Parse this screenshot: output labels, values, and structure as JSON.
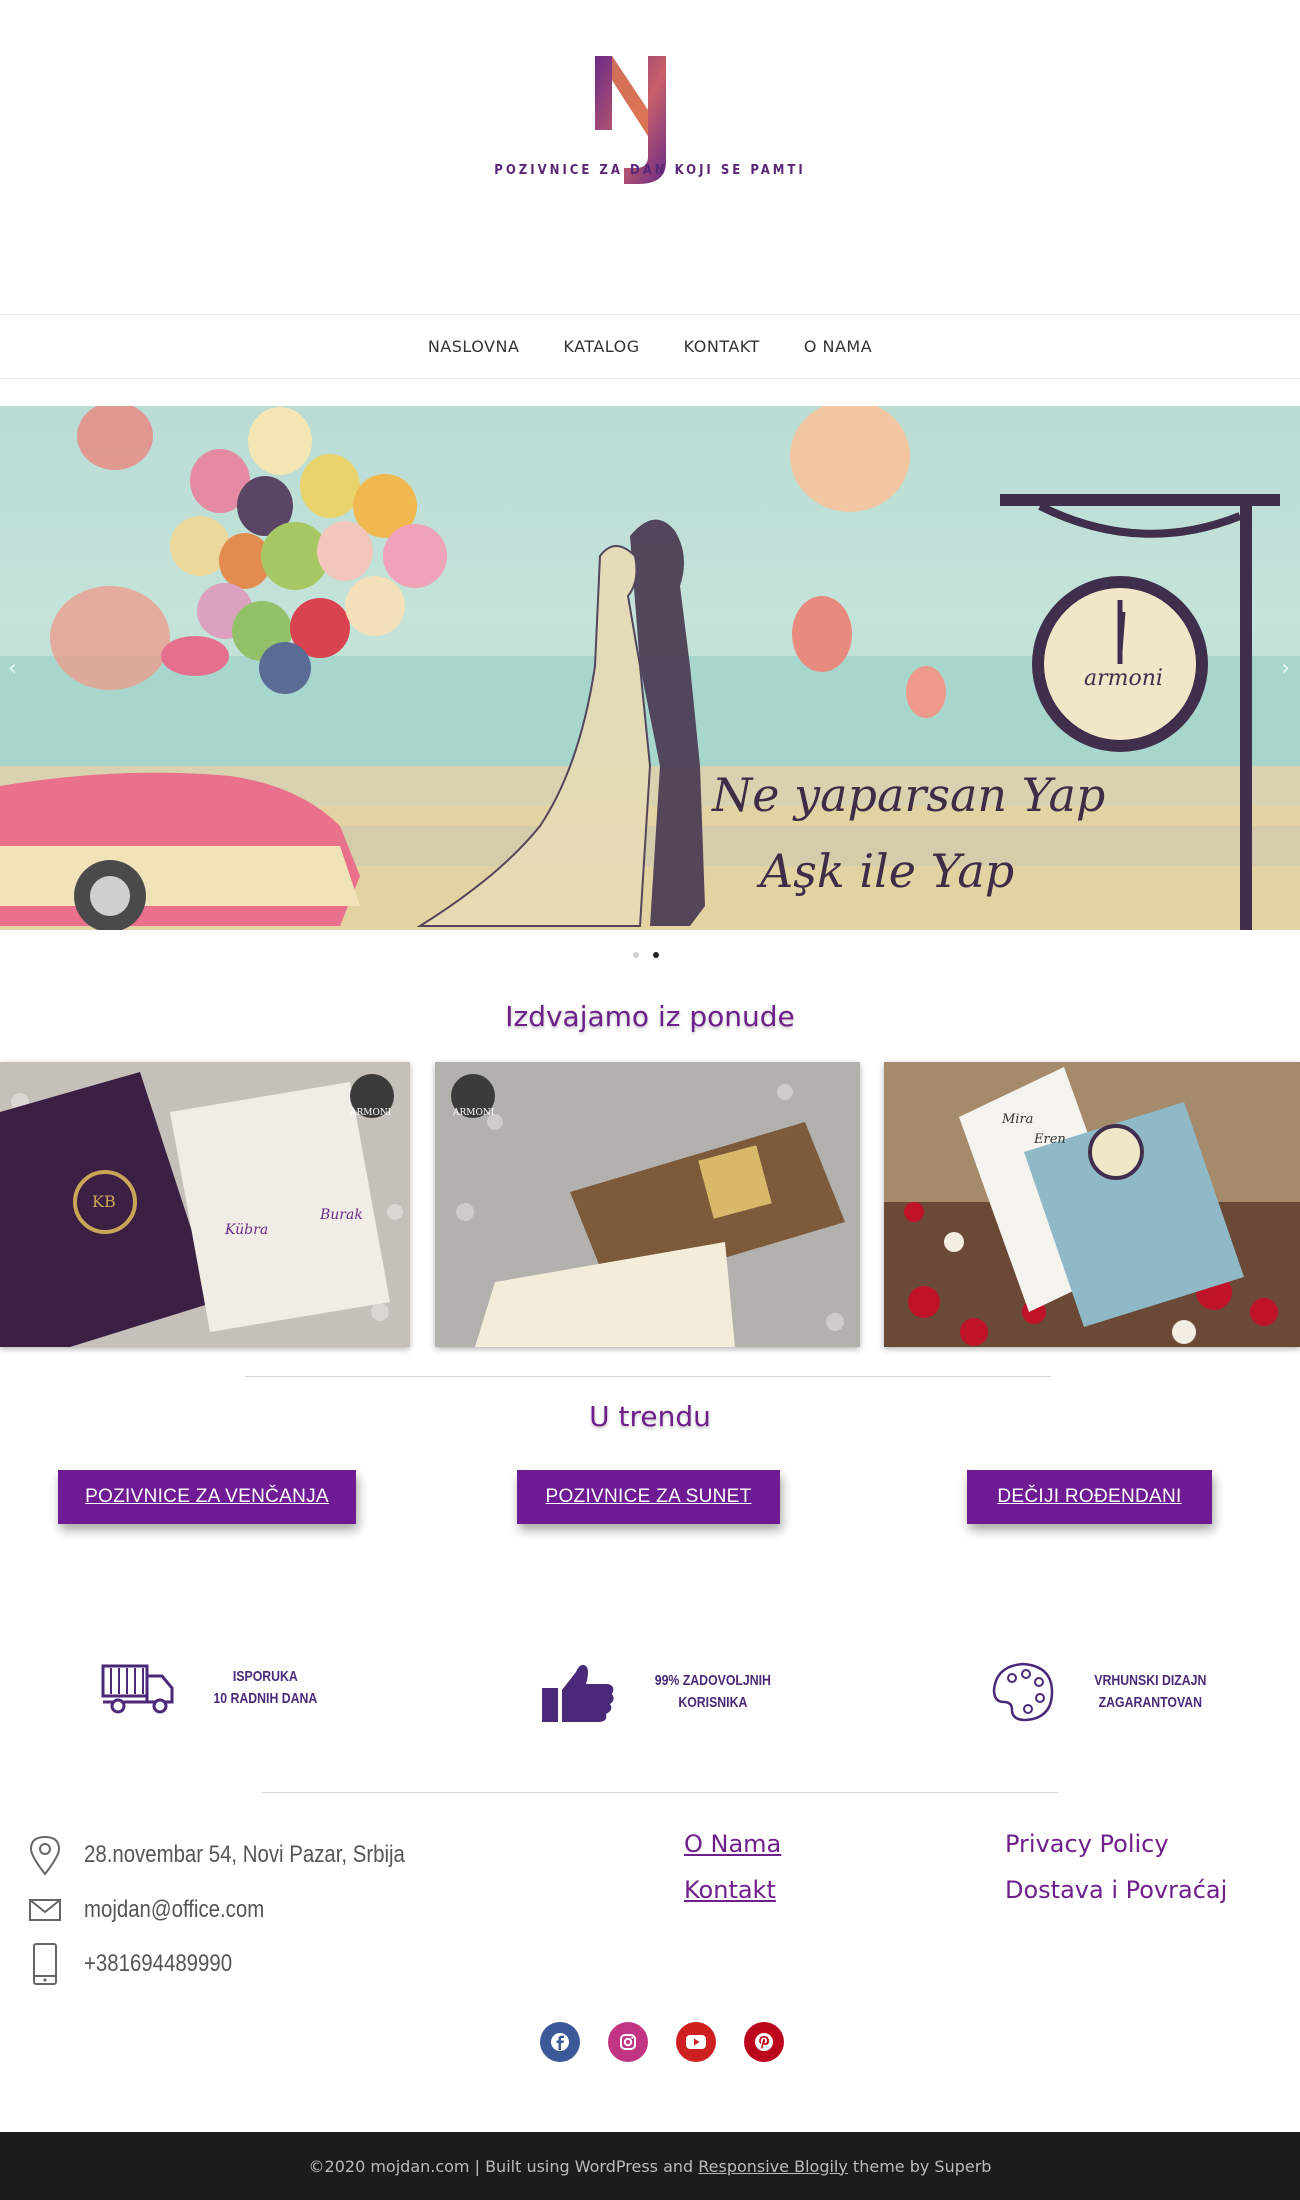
{
  "site": {
    "tagline": "POZIVNICE ZA DAN KOJI SE PAMTI"
  },
  "nav": {
    "items": [
      {
        "label": "NASLOVNA"
      },
      {
        "label": "KATALOG"
      },
      {
        "label": "KONTAKT"
      },
      {
        "label": "O NAMA"
      }
    ]
  },
  "hero": {
    "line1": "Ne yaparsan Yap",
    "line2": "Aşk ile Yap",
    "clock_brand": "armoni",
    "active_slide": 2,
    "slide_count": 2
  },
  "featured": {
    "title": "Izdvajamo iz ponude",
    "cards": [
      {
        "brand": "ARMONI",
        "monogram": "KB",
        "name_left": "Kübra",
        "name_right": "Burak"
      },
      {
        "brand": "ARMONI"
      },
      {
        "name_left": "Mira",
        "name_right": "Eren"
      }
    ]
  },
  "trend": {
    "title": "U trendu",
    "buttons": [
      {
        "label": "POZIVNICE ZA VENČANJA"
      },
      {
        "label": "POZIVNICE ZA SUNET"
      },
      {
        "label": "DEČIJI ROĐENDANI"
      }
    ]
  },
  "features": [
    {
      "icon": "truck-icon",
      "line1": "ISPORUKA",
      "line2": "10 RADNIH DANA"
    },
    {
      "icon": "thumbs-up-icon",
      "line1": "99% ZADOVOLJNIH",
      "line2": "KORISNIKA"
    },
    {
      "icon": "palette-icon",
      "line1": "VRHUNSKI DIZAJN",
      "line2": "ZAGARANTOVAN"
    }
  ],
  "contact": {
    "address": "28.novembar 54, Novi Pazar, Srbija",
    "email": "mojdan@office.com",
    "phone": "+381694489990"
  },
  "footer_links": {
    "col1": [
      {
        "label": "O Nama"
      },
      {
        "label": "Kontakt"
      }
    ],
    "col2": [
      {
        "label": "Privacy Policy"
      },
      {
        "label": "Dostava i Povraćaj"
      }
    ]
  },
  "social": [
    {
      "icon": "facebook-icon",
      "color": "#3b5998"
    },
    {
      "icon": "instagram-icon",
      "color": "#c13584"
    },
    {
      "icon": "youtube-icon",
      "color": "#cd201f"
    },
    {
      "icon": "pinterest-icon",
      "color": "#bd081c"
    }
  ],
  "footer": {
    "prefix": "©2020 mojdan.com | Built using WordPress and ",
    "theme_link": "Responsive Blogily",
    "suffix": " theme by Superb"
  },
  "colors": {
    "brand_purple": "#6f1c94",
    "brand_orange": "#e07a4f",
    "footer_bg": "#1c1c1c"
  }
}
